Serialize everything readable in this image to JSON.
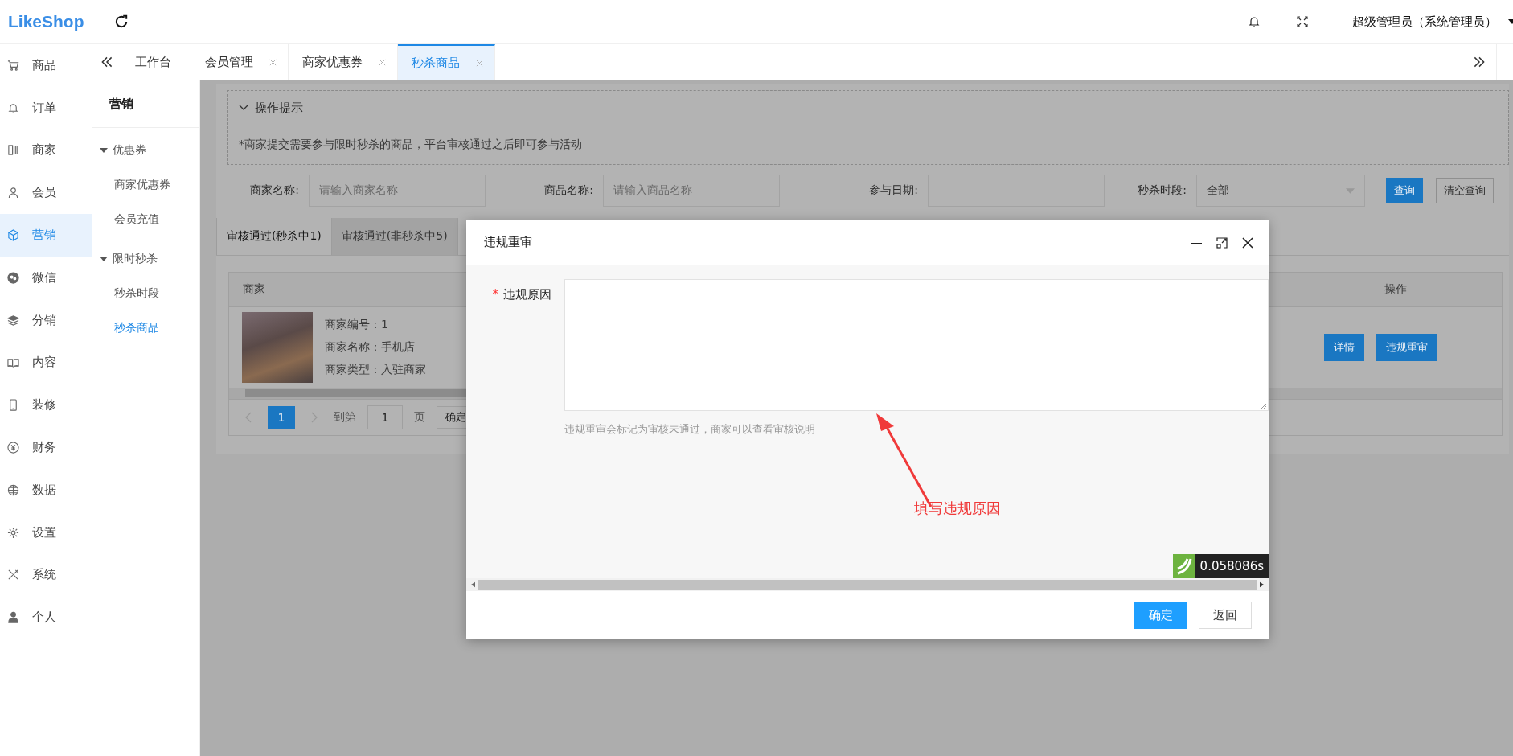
{
  "logo": "LikeShop",
  "header": {
    "user": "超级管理员（系统管理员）"
  },
  "sidebar": [
    {
      "label": "商品",
      "selected": false
    },
    {
      "label": "订单",
      "selected": false
    },
    {
      "label": "商家",
      "selected": false
    },
    {
      "label": "会员",
      "selected": false
    },
    {
      "label": "营销",
      "selected": true
    },
    {
      "label": "微信",
      "selected": false
    },
    {
      "label": "分销",
      "selected": false
    },
    {
      "label": "内容",
      "selected": false
    },
    {
      "label": "装修",
      "selected": false
    },
    {
      "label": "财务",
      "selected": false
    },
    {
      "label": "数据",
      "selected": false
    },
    {
      "label": "设置",
      "selected": false
    },
    {
      "label": "系统",
      "selected": false
    },
    {
      "label": "个人",
      "selected": false
    }
  ],
  "page_tabs": [
    {
      "label": "工作台",
      "closable": false,
      "selected": false
    },
    {
      "label": "会员管理",
      "closable": true,
      "selected": false
    },
    {
      "label": "商家优惠券",
      "closable": true,
      "selected": false
    },
    {
      "label": "秒杀商品",
      "closable": true,
      "selected": true
    }
  ],
  "subnav": {
    "title": "营销",
    "groups": [
      {
        "label": "优惠券",
        "expanded": true,
        "children": [
          {
            "label": "商家优惠券",
            "selected": false
          },
          {
            "label": "会员充值",
            "selected": false
          }
        ]
      },
      {
        "label": "限时秒杀",
        "expanded": true,
        "children": [
          {
            "label": "秒杀时段",
            "selected": false
          },
          {
            "label": "秒杀商品",
            "selected": true
          }
        ]
      }
    ]
  },
  "tips": {
    "title": "操作提示",
    "expanded": true,
    "text": "*商家提交需要参与限时秒杀的商品，平台审核通过之后即可参与活动"
  },
  "filters": [
    {
      "label": "商家名称:",
      "kind": "input",
      "placeholder": "请输入商家名称"
    },
    {
      "label": "商品名称:",
      "kind": "input",
      "placeholder": "请输入商品名称"
    },
    {
      "label": "参与日期:",
      "kind": "input"
    },
    {
      "label": "秒杀时段:",
      "kind": "select",
      "value": "全部"
    }
  ],
  "filter_buttons": [
    {
      "label": "查询",
      "kind": "primary"
    },
    {
      "label": "清空查询",
      "kind": "default"
    }
  ],
  "content_tabs": [
    {
      "label": "审核通过(秒杀中1)",
      "selected": true
    },
    {
      "label": "审核通过(非秒杀中5)",
      "selected": false
    }
  ],
  "table": {
    "columns": [
      "商家",
      "操作"
    ],
    "rows": [
      {
        "merchant_info": [
          "商家编号：1",
          "商家名称：手机店",
          "商家类型：入驻商家"
        ],
        "actions": [
          {
            "label": "详情"
          },
          {
            "label": "违规重审"
          }
        ]
      }
    ]
  },
  "pagination": {
    "pages": [
      {
        "label": "1",
        "selected": true
      }
    ],
    "goto_label": "到第",
    "goto_value": "1",
    "page_unit": "页",
    "confirm": "确定"
  },
  "dialog": {
    "title": "违规重审",
    "field_label": "违规原因",
    "required_mark": "*",
    "hint": "违规重审会标记为审核未通过，商家可以查看审核说明",
    "timer": "0.058086s",
    "buttons": [
      {
        "label": "确定",
        "kind": "primary"
      },
      {
        "label": "返回",
        "kind": "default"
      }
    ]
  },
  "annotation": {
    "text": "填写违规原因"
  }
}
